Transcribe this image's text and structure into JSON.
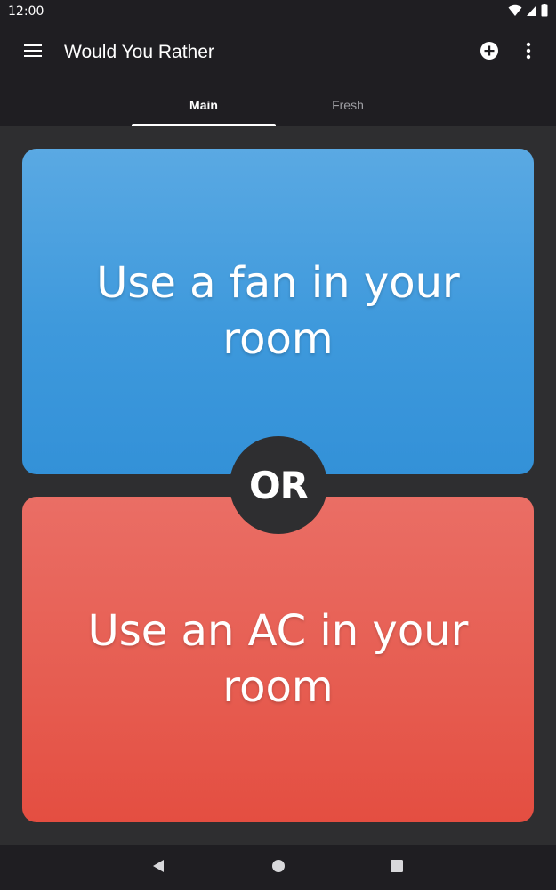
{
  "status_bar": {
    "time": "12:00",
    "icons": [
      "wifi-icon",
      "signal-icon",
      "battery-icon"
    ]
  },
  "app_bar": {
    "title": "Would You Rather",
    "menu_icon": "menu-icon",
    "add_icon": "add-circle-icon",
    "more_icon": "more-vert-icon"
  },
  "tabs": [
    {
      "label": "Main",
      "active": true
    },
    {
      "label": "Fresh",
      "active": false
    }
  ],
  "question": {
    "option_a": "Use a fan in your room",
    "separator": "OR",
    "option_b": "Use an AC in your room"
  },
  "nav_bar": {
    "icons": [
      "back-icon",
      "home-icon",
      "recents-icon"
    ]
  },
  "colors": {
    "app_bar_bg": "#1f1e22",
    "background": "#2e2e30",
    "option_a": "#3e99dc",
    "option_b": "#e65c50",
    "text": "#ffffff"
  }
}
